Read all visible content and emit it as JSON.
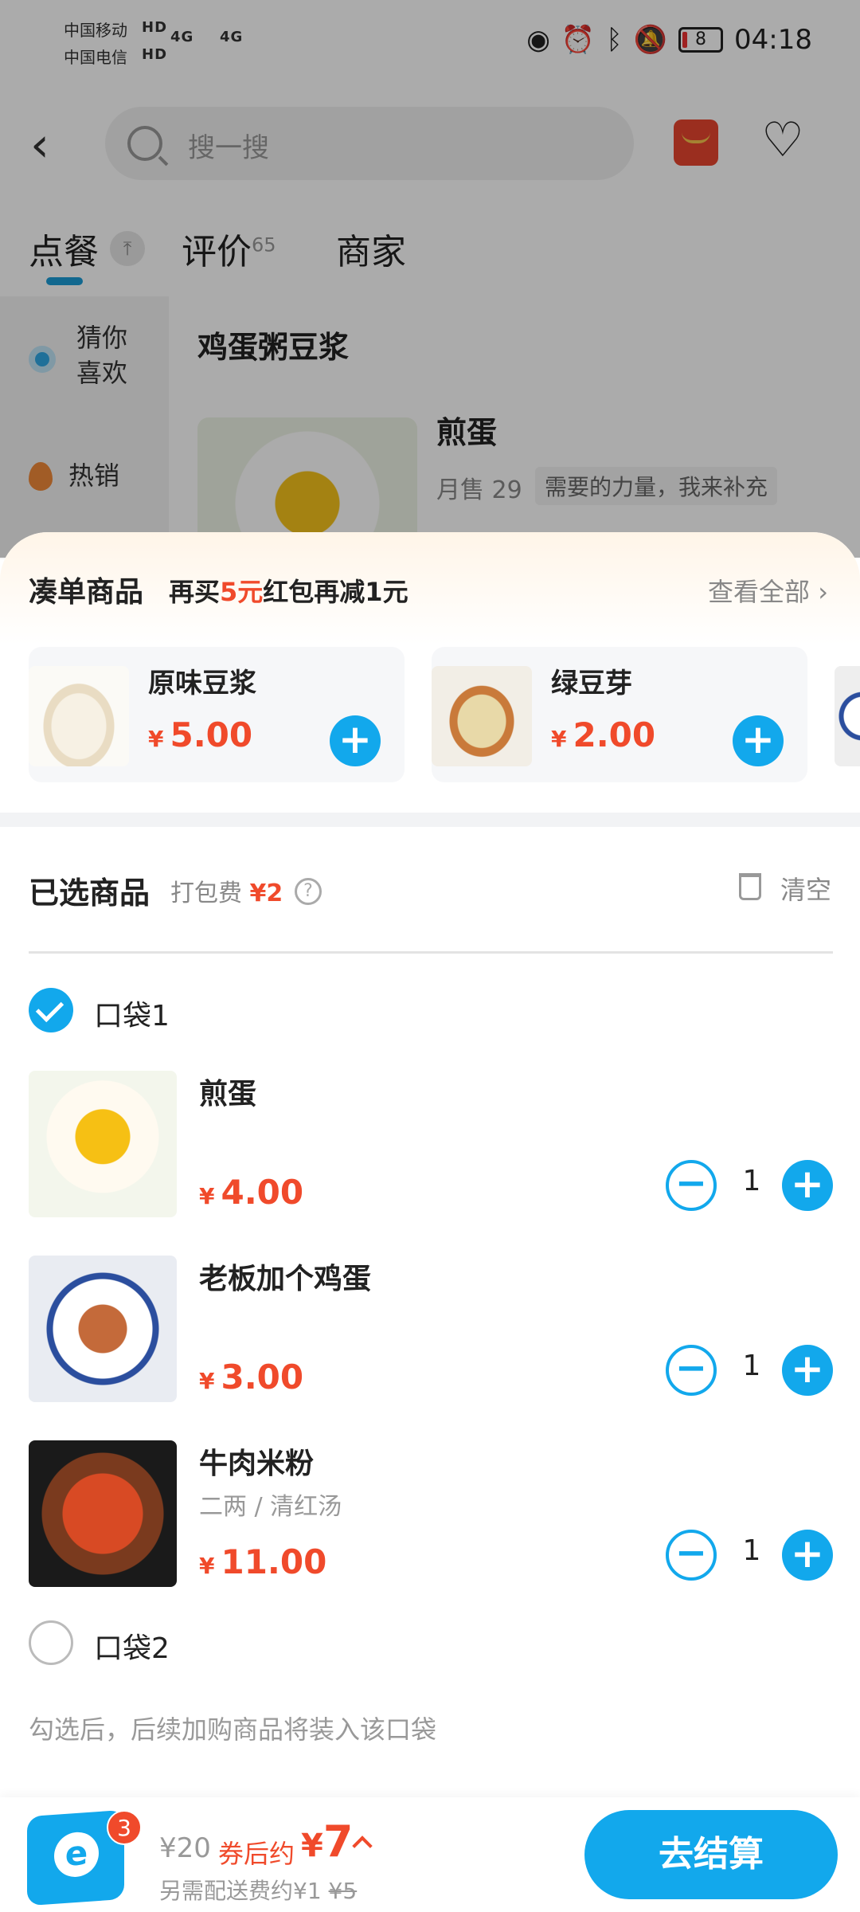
{
  "status_bar": {
    "carrier_1": "中国移动",
    "carrier_2": "中国电信",
    "hd": "HD",
    "network": "4G",
    "battery": "8",
    "time": "04:18"
  },
  "top_nav": {
    "search_placeholder": "搜一搜"
  },
  "tabs": [
    {
      "label": "点餐",
      "badge": ""
    },
    {
      "label": "评价",
      "badge": "65"
    },
    {
      "label": "商家",
      "badge": ""
    }
  ],
  "side_menu": {
    "items": [
      "猜你\n喜欢",
      "热销"
    ]
  },
  "menu_section": {
    "title": "鸡蛋粥豆浆",
    "item_name": "煎蛋",
    "sales": "月售 29",
    "tag": "需要的力量，我来补充"
  },
  "combo": {
    "title": "凑单商品",
    "promo_prefix": "再买",
    "promo_amount": "5元",
    "promo_suffix": "红包再减1元",
    "see_all": "查看全部",
    "items": [
      {
        "name": "原味豆浆",
        "currency": "¥",
        "price": "5.00"
      },
      {
        "name": "绿豆芽",
        "currency": "¥",
        "price": "2.00"
      }
    ]
  },
  "selected": {
    "title": "已选商品",
    "pack_fee_label": "打包费",
    "pack_fee_value": "¥2",
    "clear_label": "清空",
    "bags": [
      {
        "label": "口袋1",
        "checked": true
      },
      {
        "label": "口袋2",
        "checked": false
      }
    ],
    "items": [
      {
        "name": "煎蛋",
        "spec": "",
        "currency": "¥",
        "price": "4.00",
        "qty": "1"
      },
      {
        "name": "老板加个鸡蛋",
        "spec": "",
        "currency": "¥",
        "price": "3.00",
        "qty": "1"
      },
      {
        "name": "牛肉米粉",
        "spec": "二两 / 清红汤",
        "currency": "¥",
        "price": "11.00",
        "qty": "1"
      }
    ],
    "hint": "勾选后，后续加购商品将装入该口袋"
  },
  "cart_bar": {
    "badge": "3",
    "orig_total": "¥20",
    "after_label": "券后约",
    "after_currency": "¥",
    "after_value": "7",
    "delivery_label": "另需配送费约¥1",
    "delivery_old": "¥5",
    "checkout_label": "去结算"
  },
  "colors": {
    "accent": "#12a8ec",
    "price_red": "#f04a2b"
  }
}
